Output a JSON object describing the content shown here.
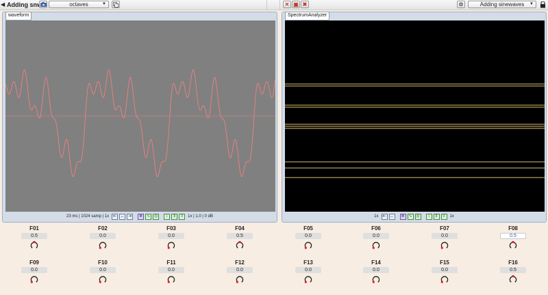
{
  "toolbar": {
    "plugin_name": "Adding snwv",
    "preset_select": "octaves",
    "preset_program": "Adding sinewaves"
  },
  "waveform_panel": {
    "title": "waveform",
    "footer_text": "23 ms | 1024 samp | 1x",
    "footer_text2": "1x | 1.0 | 0 dB"
  },
  "spectrum_panel": {
    "title": "SpectrumAnalyzer",
    "footer_zoom": "1x",
    "footer_zoom2": "1x"
  },
  "colors": {
    "background": "#f8ede3",
    "waveform_bg": "#808080",
    "waveform_line": "#f08080",
    "spectrum_bg": "#000000",
    "spectrum_line": "#e0c070",
    "knob_pointer": "#e8201a"
  },
  "knobs": [
    {
      "label": "F01",
      "value": "0.5",
      "level": 0.5
    },
    {
      "label": "F02",
      "value": "0.0",
      "level": 0.0
    },
    {
      "label": "F03",
      "value": "0.0",
      "level": 0.0
    },
    {
      "label": "F04",
      "value": "0.5",
      "level": 0.5
    },
    {
      "label": "F05",
      "value": "0.0",
      "level": 0.0
    },
    {
      "label": "F06",
      "value": "0.0",
      "level": 0.0
    },
    {
      "label": "F07",
      "value": "0.0",
      "level": 0.0
    },
    {
      "label": "F08",
      "value": "0.5",
      "level": 0.5
    },
    {
      "label": "F09",
      "value": "0.0",
      "level": 0.0
    },
    {
      "label": "F10",
      "value": "0.0",
      "level": 0.0
    },
    {
      "label": "F11",
      "value": "0.0",
      "level": 0.0
    },
    {
      "label": "F12",
      "value": "0.0",
      "level": 0.0
    },
    {
      "label": "F13",
      "value": "0.0",
      "level": 0.0
    },
    {
      "label": "F14",
      "value": "0.0",
      "level": 0.0
    },
    {
      "label": "F15",
      "value": "0.0",
      "level": 0.0
    },
    {
      "label": "F16",
      "value": "0.5",
      "level": 0.5
    }
  ]
}
